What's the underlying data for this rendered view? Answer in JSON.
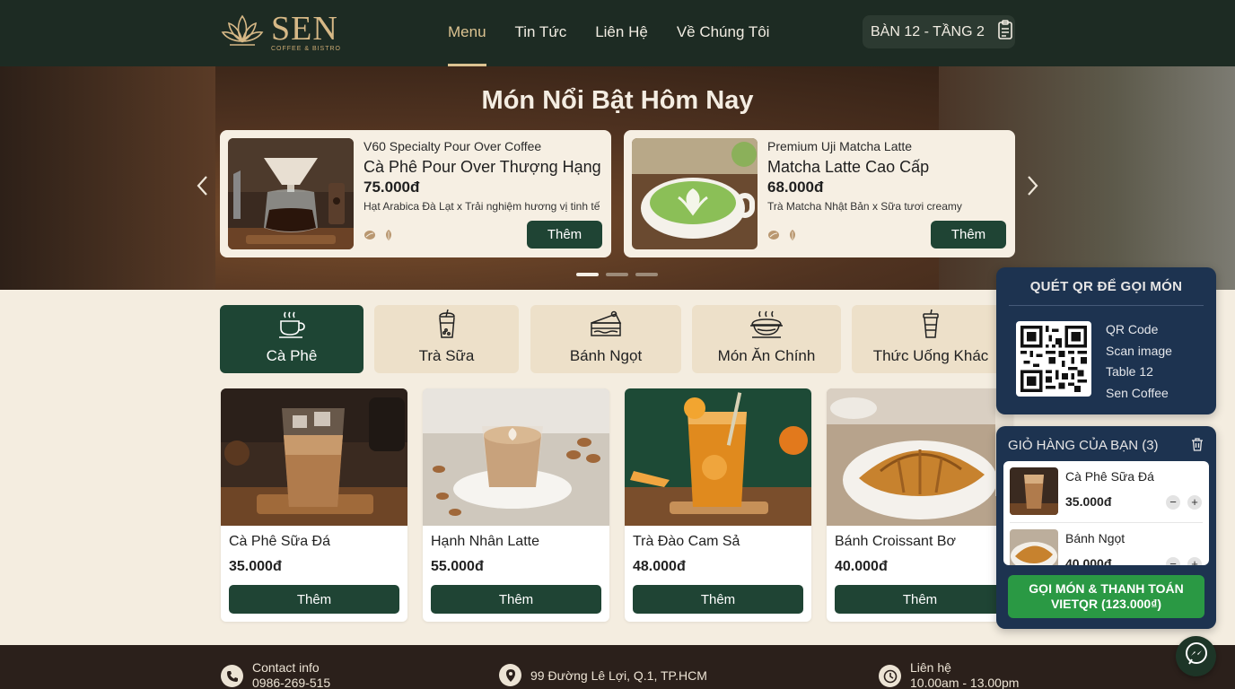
{
  "brand": {
    "name": "SEN",
    "tagline": "COFFEE & BISTRO"
  },
  "nav": {
    "items": [
      {
        "label": "Menu",
        "active": true
      },
      {
        "label": "Tin Tức",
        "active": false
      },
      {
        "label": "Liên Hệ",
        "active": false
      },
      {
        "label": "Về Chúng Tôi",
        "active": false
      }
    ],
    "table_label": "BÀN 12 - TẦNG 2",
    "table_icon": "clipboard-icon"
  },
  "hero": {
    "title": "Món Nổi Bật Hôm Nay",
    "featured": [
      {
        "subtitle": "V60 Specialty Pour Over Coffee",
        "name": "Cà Phê Pour Over Thượng Hạng",
        "price": "75.000đ",
        "desc": "Hạt Arabica Đà Lạt x Trải nghiệm hương vị tinh tế",
        "button": "Thêm"
      },
      {
        "subtitle": "Premium Uji Matcha Latte",
        "name": "Matcha Latte Cao Cấp",
        "price": "68.000đ",
        "desc": "Trà Matcha Nhật Bản x Sữa tươi creamy",
        "button": "Thêm"
      }
    ],
    "prev_icon": "chevron-left-icon",
    "next_icon": "chevron-right-icon",
    "slides": 3,
    "active_slide": 1
  },
  "categories": [
    {
      "label": "Cà Phê",
      "icon": "coffee-cup-icon",
      "active": true
    },
    {
      "label": "Trà Sữa",
      "icon": "bubble-tea-icon",
      "active": false
    },
    {
      "label": "Bánh Ngọt",
      "icon": "cake-icon",
      "active": false
    },
    {
      "label": "Món Ăn Chính",
      "icon": "hot-dish-icon",
      "active": false
    },
    {
      "label": "Thức Uống Khác",
      "icon": "drink-cup-icon",
      "active": false
    }
  ],
  "products": [
    {
      "name": "Cà Phê Sữa Đá",
      "price": "35.000đ",
      "button": "Thêm"
    },
    {
      "name": "Hạnh Nhân Latte",
      "price": "55.000đ",
      "button": "Thêm"
    },
    {
      "name": "Trà Đào Cam Sả",
      "price": "48.000đ",
      "button": "Thêm"
    },
    {
      "name": "Bánh Croissant Bơ",
      "price": "40.000đ",
      "button": "Thêm"
    }
  ],
  "qr_panel": {
    "title": "QUÉT QR ĐỂ GỌI MÓN",
    "lines": [
      "QR Code",
      "Scan image",
      "Table 12",
      "Sen Coffee"
    ]
  },
  "cart": {
    "title": "GIỎ HÀNG CỦA BẠN (3)",
    "items": [
      {
        "name": "Cà Phê Sữa Đá",
        "price": "35.000đ"
      },
      {
        "name": "Bánh Ngọt",
        "price": "40.000đ"
      }
    ],
    "minus": "−",
    "plus": "+",
    "pay_line1": "GỌI MÓN & THANH TOÁN",
    "pay_line2": "VIETQR (123.000₫)"
  },
  "footer": {
    "contact_label": "Contact info",
    "contact_phone": "0986-269-515",
    "address": "99 Đường Lê Lợi, Q.1, TP.HCM",
    "hours_label": "Liên hệ",
    "hours": "10.00am - 13.00pm"
  },
  "colors": {
    "nav_bg": "#1d2b23",
    "accent_gold": "#dcc391",
    "primary_green": "#1f4434",
    "panel_navy": "#1d3350",
    "pay_green": "#2a9944"
  }
}
